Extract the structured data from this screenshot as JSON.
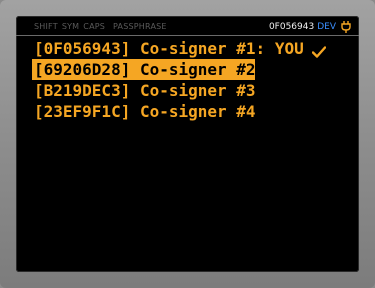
{
  "statusbar": {
    "shift_label": "SHIFT",
    "sym_label": "SYM",
    "caps_label": "CAPS",
    "passphrase_label": "PASSPHRASE",
    "xfp": "0F056943",
    "dev_label": "DEV",
    "power_icon": "plug-icon"
  },
  "cosigners": [
    {
      "label": "[0F056943] Co-signer #1: YOU",
      "is_self": true,
      "selected": false
    },
    {
      "label": "[69206D28] Co-signer #2",
      "is_self": false,
      "selected": true
    },
    {
      "label": "[B219DEC3] Co-signer #3",
      "is_self": false,
      "selected": false
    },
    {
      "label": "[23EF9F1C] Co-signer #4",
      "is_self": false,
      "selected": false
    }
  ],
  "icons": {
    "self_marker": "checkmark-icon"
  },
  "colors": {
    "accent": "#f5a623",
    "dev": "#3b8fff",
    "screen_bg": "#000000",
    "bezel": "#8d8d8d"
  }
}
